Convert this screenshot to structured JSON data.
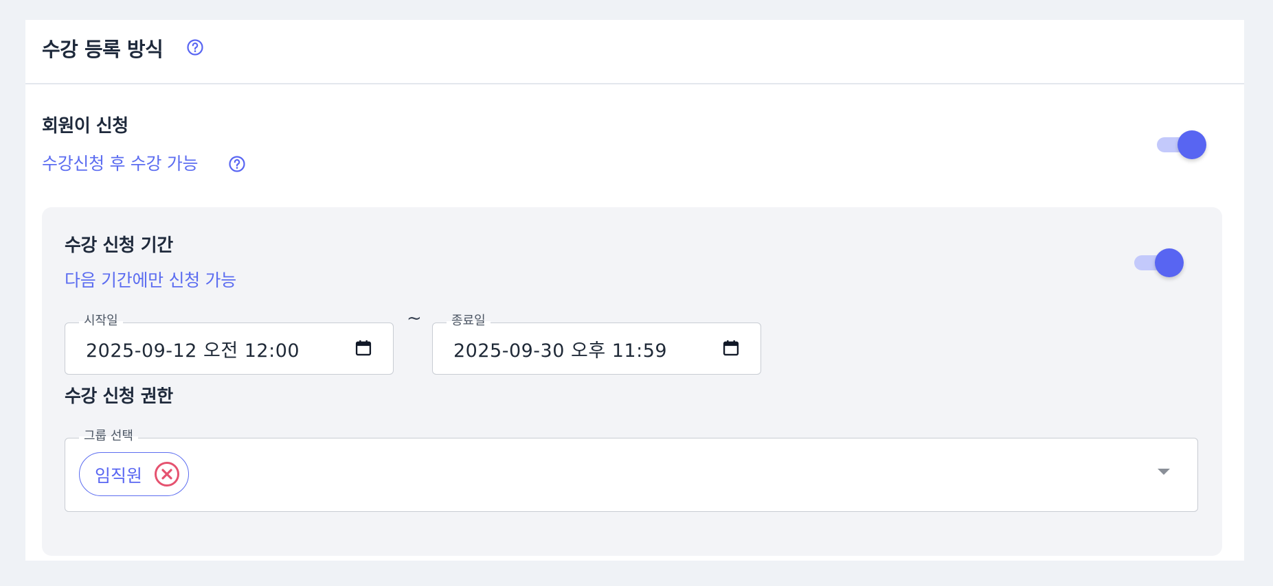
{
  "section": {
    "title": "수강 등록 방식"
  },
  "member_apply": {
    "title": "회원이 신청",
    "subtitle": "수강신청 후 수강 가능",
    "enabled": true
  },
  "apply_period": {
    "title": "수강 신청 기간",
    "subtitle": "다음 기간에만 신청 가능",
    "enabled": true,
    "start": {
      "label": "시작일",
      "value": "2025-09-12 오전 12:00"
    },
    "separator": "~",
    "end": {
      "label": "종료일",
      "value": "2025-09-30 오후 11:59"
    }
  },
  "apply_permission": {
    "title": "수강 신청 권한",
    "group_select": {
      "label": "그룹 선택",
      "chips": [
        "임직원"
      ]
    }
  },
  "colors": {
    "accent": "#5865f2",
    "accent_light": "#c3c9fb",
    "remove": "#e5526f",
    "panel_bg": "#f3f4f7",
    "page_bg": "#eff2f6"
  },
  "icons": {
    "help": "question-circle-icon",
    "calendar": "calendar-icon",
    "remove": "close-circle-icon",
    "dropdown": "caret-down-icon"
  }
}
